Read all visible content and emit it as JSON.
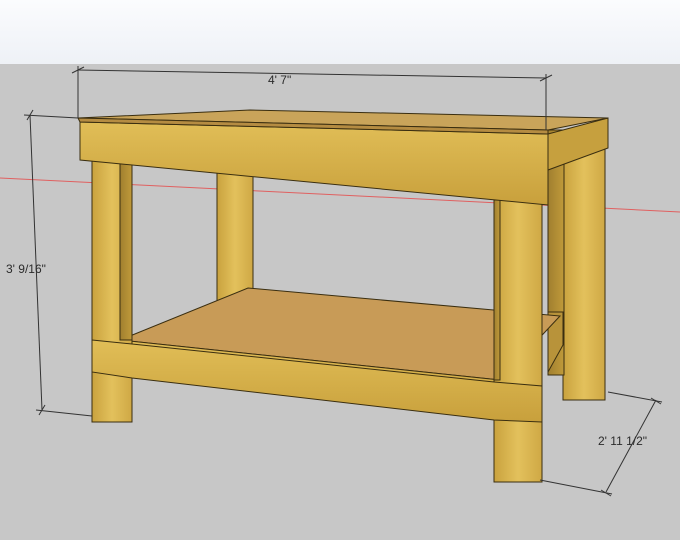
{
  "dimensions": {
    "width": "4' 7\"",
    "height": "3' 9/16\"",
    "depth": "2' 11 1/2\""
  },
  "colors": {
    "sky": "#eef1f6",
    "ground": "#c7c7c7",
    "wood_light": "#e0bd55",
    "wood_mid": "#c9a23e",
    "wood_dark": "#9a7b2e",
    "plywood": "#c79a55",
    "red_axis": "#e06060",
    "dimension_line": "#333333"
  }
}
